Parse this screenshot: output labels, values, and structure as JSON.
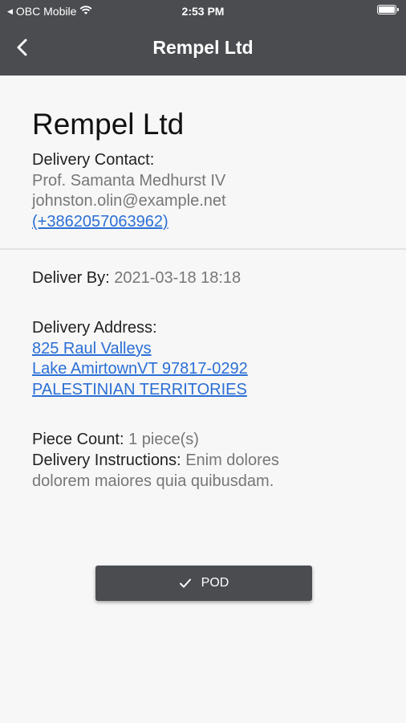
{
  "status_bar": {
    "carrier": "OBC Mobile",
    "time": "2:53 PM"
  },
  "nav": {
    "title": "Rempel Ltd"
  },
  "contact": {
    "company": "Rempel Ltd",
    "label": "Delivery Contact:",
    "name": "Prof. Samanta Medhurst IV",
    "email": "johnston.olin@example.net",
    "phone": "(+3862057063962)"
  },
  "deliver_by": {
    "label": "Deliver By:",
    "value": "2021-03-18 18:18"
  },
  "address": {
    "label": "Delivery Address:",
    "line1": "825 Raul Valleys",
    "line2": "Lake AmirtownVT 97817-0292",
    "line3": "PALESTINIAN TERRITORIES"
  },
  "piece_count": {
    "label": "Piece Count:",
    "value": "1 piece(s)"
  },
  "instructions": {
    "label": "Delivery Instructions:",
    "value_line1": "Enim dolores",
    "value_line2": "dolorem maiores quia quibusdam."
  },
  "pod_button": {
    "label": "POD",
    "icon": "check-icon"
  },
  "colors": {
    "header_bg": "#4a4c50",
    "link": "#2b6fd6",
    "background": "#f7f7f7"
  }
}
